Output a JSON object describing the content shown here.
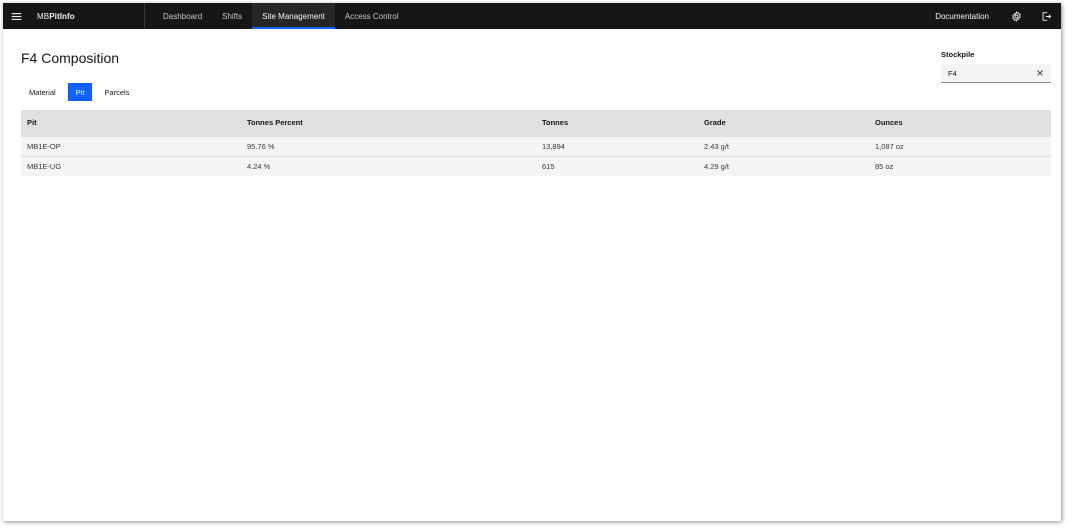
{
  "header": {
    "brand_prefix": "MB",
    "brand_bold": "PitInfo",
    "nav": [
      {
        "label": "Dashboard"
      },
      {
        "label": "Shifts"
      },
      {
        "label": "Site Management"
      },
      {
        "label": "Access Control"
      }
    ],
    "active_nav": "Site Management",
    "documentation": "Documentation"
  },
  "page": {
    "title": "F4 Composition"
  },
  "stockpile": {
    "label": "Stockpile",
    "value": "F4"
  },
  "tabs": [
    {
      "label": "Material"
    },
    {
      "label": "Pit"
    },
    {
      "label": "Parcels"
    }
  ],
  "active_tab": "Pit",
  "table": {
    "columns": [
      "Pit",
      "Tonnes Percent",
      "Tonnes",
      "Grade",
      "Ounces"
    ],
    "rows": [
      [
        "MB1E-OP",
        "95.76 %",
        "13,894",
        "2.43 g/t",
        "1,087 oz"
      ],
      [
        "MB1E-UG",
        "4.24 %",
        "615",
        "4.29 g/t",
        "85 oz"
      ]
    ]
  },
  "colors": {
    "header_bg": "#161616",
    "accent": "#0f62fe"
  }
}
